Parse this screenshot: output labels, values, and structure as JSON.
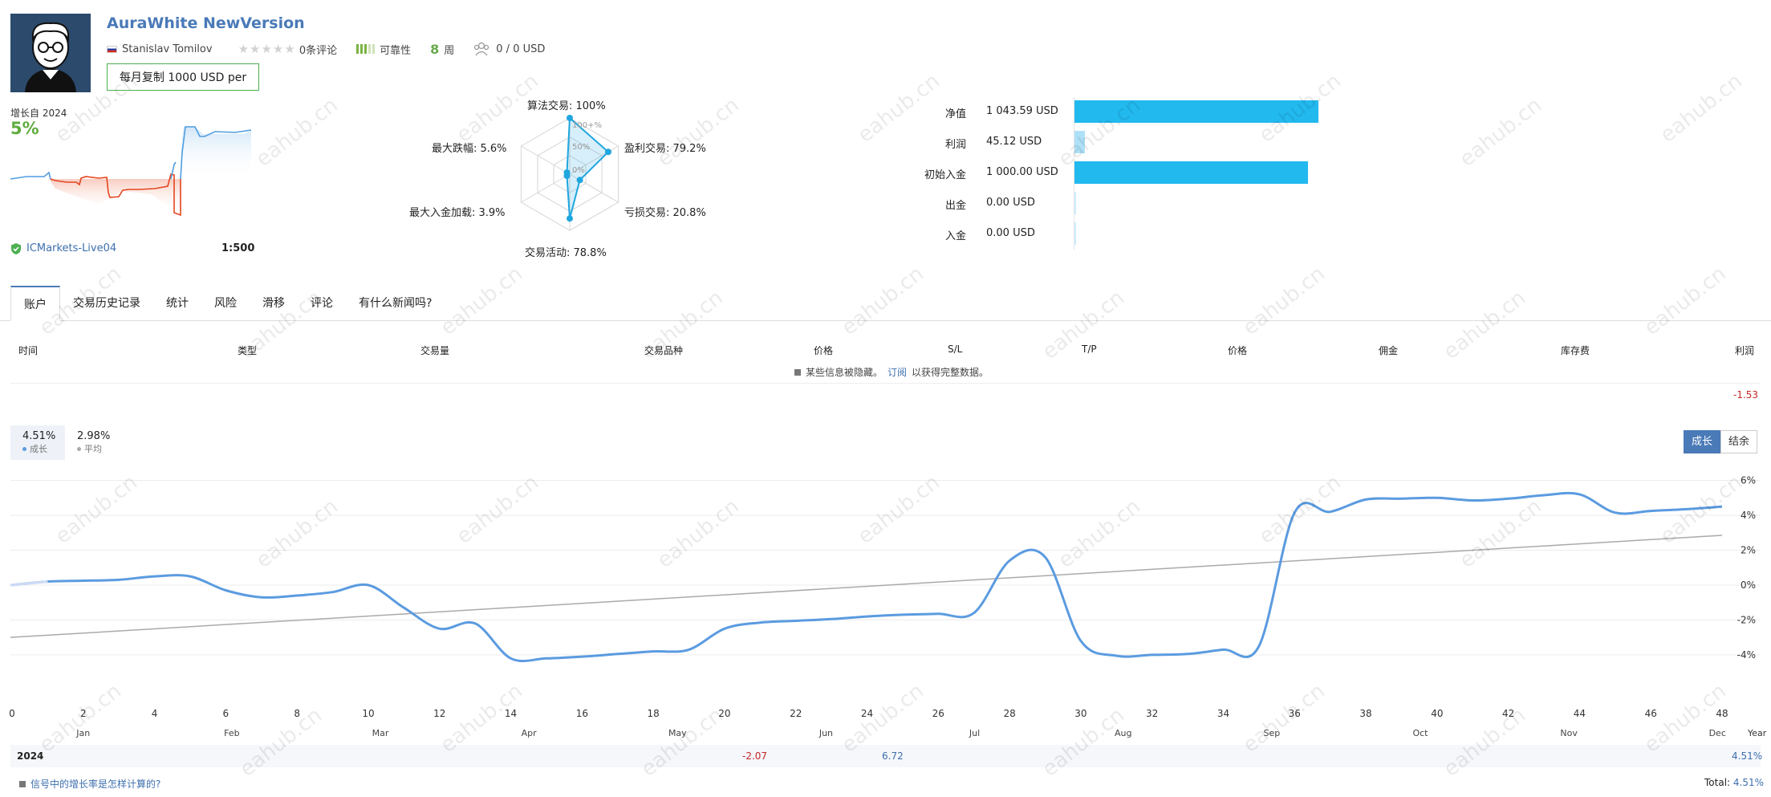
{
  "header": {
    "title": "AuraWhite NewVersion",
    "author": "Stanislav Tomilov",
    "reviews": "0条评论",
    "reliability_label": "可靠性",
    "weeks_value": "8",
    "weeks_unit": "周",
    "subscribers": "0 / 0 USD",
    "copy_button": "每月复制 1000 USD per"
  },
  "growth": {
    "label": "增长自 2024",
    "value": "5%",
    "broker": "ICMarkets-Live04",
    "leverage": "1:500"
  },
  "radar": {
    "labels": {
      "algo": "算法交易: 100%",
      "profit": "盈利交易: 79.2%",
      "loss": "亏损交易: 20.8%",
      "activity": "交易活动: 78.8%",
      "load": "最大入金加载: 3.9%",
      "drawdown": "最大跌幅: 5.6%"
    },
    "scale": [
      "100+%",
      "50%",
      "0%"
    ],
    "values": [
      100,
      79.2,
      20.8,
      78.8,
      3.9,
      5.6
    ]
  },
  "balance": {
    "rows": [
      {
        "label": "净值",
        "value": "1 043.59 USD",
        "amount": 1043.59
      },
      {
        "label": "利润",
        "value": "45.12 USD",
        "amount": 45.12
      },
      {
        "label": "初始入金",
        "value": "1 000.00 USD",
        "amount": 1000.0
      },
      {
        "label": "出金",
        "value": "0.00 USD",
        "amount": 0
      },
      {
        "label": "入金",
        "value": "0.00 USD",
        "amount": 0
      }
    ]
  },
  "tabs": [
    "账户",
    "交易历史记录",
    "统计",
    "风险",
    "滑移",
    "评论",
    "有什么新闻吗?"
  ],
  "table": {
    "headers": [
      "时间",
      "类型",
      "交易量",
      "交易品种",
      "价格",
      "S/L",
      "T/P",
      "价格",
      "佣金",
      "库存费",
      "利润"
    ],
    "hidden_note": "某些信息被隐藏。",
    "hidden_link": "订阅",
    "hidden_note_tail": "以获得完整数据。",
    "profit_total": "-1.53"
  },
  "chart_legend": {
    "growth_value": "4.51%",
    "growth_label": "成长",
    "avg_value": "2.98%",
    "avg_label": "平均"
  },
  "chart_toggle": {
    "growth": "成长",
    "balance": "结余"
  },
  "chart_data": {
    "type": "line",
    "x_ticks": [
      "0",
      "2",
      "4",
      "6",
      "8",
      "10",
      "12",
      "14",
      "16",
      "18",
      "20",
      "22",
      "24",
      "26",
      "28",
      "30",
      "32",
      "34",
      "36",
      "38",
      "40",
      "42",
      "44",
      "46",
      "48"
    ],
    "x_label": "Year",
    "months": [
      "Jan",
      "Feb",
      "Mar",
      "Apr",
      "May",
      "Jun",
      "Jul",
      "Aug",
      "Sep",
      "Oct",
      "Nov",
      "Dec"
    ],
    "y_ticks": [
      "6%",
      "4%",
      "2%",
      "0%",
      "-2%",
      "-4%"
    ],
    "ylim": [
      -5.2,
      6.3
    ],
    "xlim": [
      0,
      48
    ],
    "colors": {
      "growth": "#5b9be0",
      "average": "#aaaaaa"
    },
    "series": [
      {
        "name": "成长",
        "x": [
          0,
          1,
          2,
          3,
          4,
          5,
          6,
          7,
          8,
          9,
          10,
          11,
          12,
          13,
          14,
          15,
          16,
          17,
          18,
          19,
          20,
          21,
          22,
          23,
          24,
          25,
          26,
          27,
          28,
          29,
          30,
          31,
          32,
          33,
          34,
          35,
          36,
          37,
          38,
          39,
          40,
          41,
          42,
          43,
          44,
          45,
          46,
          47,
          48
        ],
        "values": [
          0,
          0.2,
          0.25,
          0.3,
          0.5,
          0.5,
          -0.3,
          -0.7,
          -0.6,
          -0.4,
          0,
          -1.3,
          -2.5,
          -2.2,
          -4.2,
          -4.2,
          -4.1,
          -3.95,
          -3.8,
          -3.7,
          -2.5,
          -2.15,
          -2.05,
          -1.95,
          -1.8,
          -1.7,
          -1.65,
          -1.6,
          1.4,
          1.6,
          -3.2,
          -4.05,
          -4.0,
          -3.95,
          -3.7,
          -3.5,
          4.15,
          4.2,
          4.9,
          4.95,
          5.0,
          4.85,
          4.95,
          5.15,
          5.2,
          4.15,
          4.25,
          4.35,
          4.5
        ]
      },
      {
        "name": "平均",
        "x": [
          0,
          48
        ],
        "values": [
          -3.0,
          2.85
        ]
      }
    ]
  },
  "year_row": {
    "year": "2024",
    "may": "-2.07",
    "jun": "6.72",
    "year_total": "4.51%"
  },
  "footer": {
    "question": "信号中的增长率是怎样计算的?",
    "total_label": "Total:",
    "total_value": "4.51%"
  },
  "watermark": "eahub.cn"
}
